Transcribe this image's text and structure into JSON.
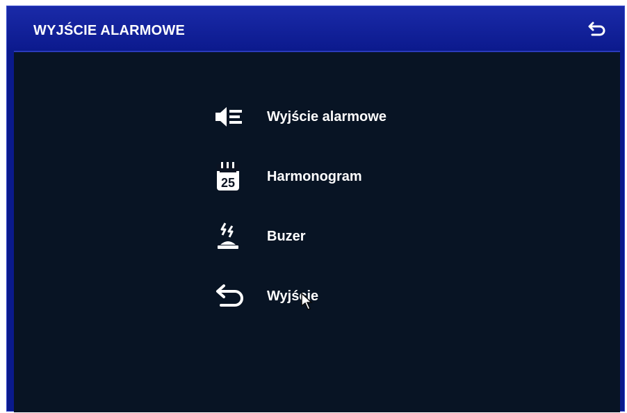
{
  "header": {
    "title": "WYJŚCIE ALARMOWE",
    "back_icon": "back-arrow-icon"
  },
  "menu": {
    "items": [
      {
        "label": "Wyjście alarmowe",
        "icon": "alarm-output-icon"
      },
      {
        "label": "Harmonogram",
        "icon": "calendar-icon",
        "icon_text": "25"
      },
      {
        "label": "Buzer",
        "icon": "buzzer-icon"
      },
      {
        "label": "Wyjście",
        "icon": "exit-arrow-icon"
      }
    ]
  },
  "colors": {
    "window_blue": "#0a1a8c",
    "content_bg": "#081424",
    "text": "#ffffff"
  }
}
